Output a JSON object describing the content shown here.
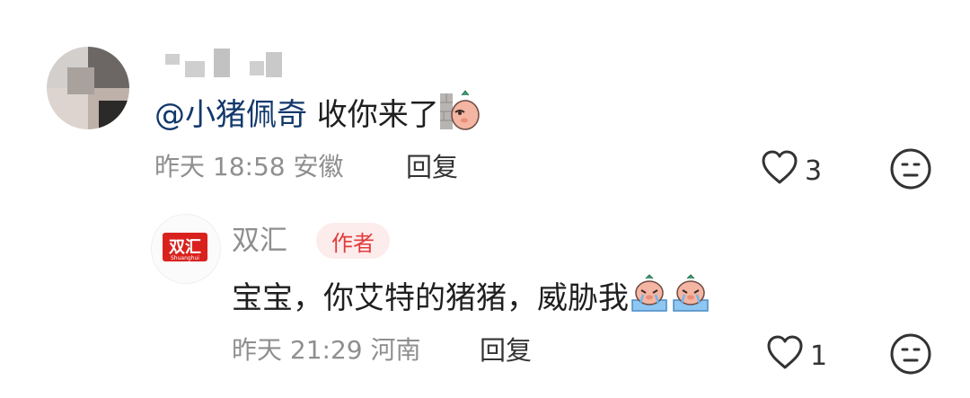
{
  "comment": {
    "mention": "@小猪佩奇",
    "text": " 收你来了",
    "sticker_icon": "pig-peek-sticker-icon",
    "time": "昨天 18:58",
    "location": "安徽",
    "reply_label": "回复",
    "like_count": "3"
  },
  "reply": {
    "author_name": "双汇",
    "author_logo_text": "双汇",
    "author_logo_subtext": "Shuanghui",
    "author_badge": "作者",
    "text": "宝宝，你艾特的猪猪，威胁我",
    "sticker_icon": "crying-pig-sticker-icon",
    "time": "昨天 21:29",
    "location": "河南",
    "reply_label": "回复",
    "like_count": "1"
  },
  "colors": {
    "mention": "#13386c",
    "meta": "#8f8f8f",
    "badge_bg": "#fdecec",
    "badge_text": "#e23b3b",
    "logo_red": "#d9221d"
  }
}
